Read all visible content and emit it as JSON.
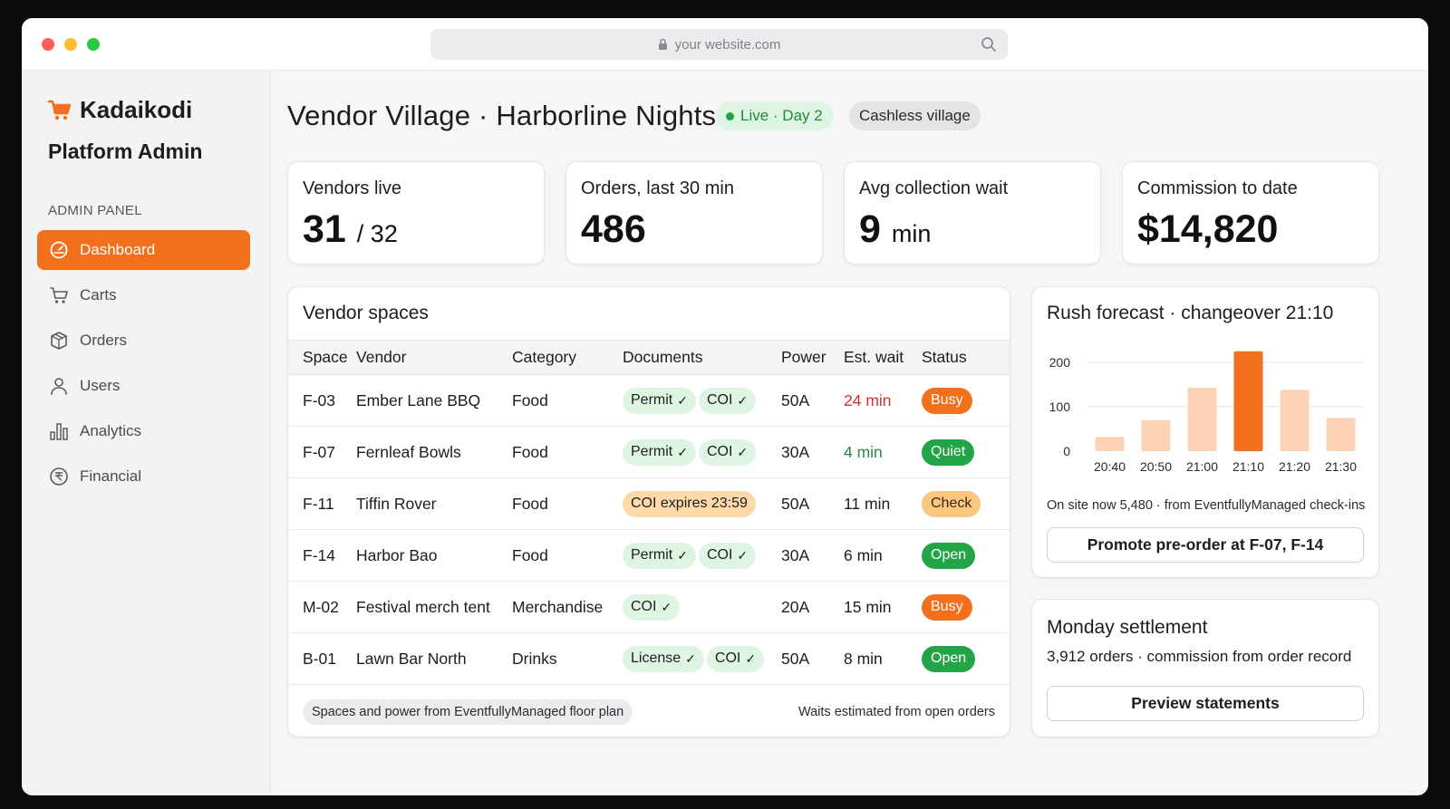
{
  "browser": {
    "url": "your website.com"
  },
  "brand": {
    "name": "Kadaikodi",
    "subtitle": "Platform Admin"
  },
  "sidebar": {
    "section_label": "ADMIN PANEL",
    "items": [
      {
        "label": "Dashboard",
        "icon": "gauge-icon",
        "active": true
      },
      {
        "label": "Carts",
        "icon": "cart-icon"
      },
      {
        "label": "Orders",
        "icon": "box-icon"
      },
      {
        "label": "Users",
        "icon": "user-icon"
      },
      {
        "label": "Analytics",
        "icon": "bar-chart-icon"
      },
      {
        "label": "Financial",
        "icon": "rupee-icon"
      }
    ]
  },
  "header": {
    "title": "Vendor Village · Harborline Nights",
    "live_pill": "Live · Day 2",
    "cash_pill": "Cashless village"
  },
  "kpis": [
    {
      "label": "Vendors live",
      "value": "31",
      "suffix": "/ 32"
    },
    {
      "label": "Orders, last 30 min",
      "value": "486",
      "suffix": ""
    },
    {
      "label": "Avg collection wait",
      "value": "9",
      "suffix": "min"
    },
    {
      "label": "Commission to date",
      "value": "$14,820",
      "suffix": ""
    }
  ],
  "vendor_spaces": {
    "title": "Vendor spaces",
    "columns": [
      "Space",
      "Vendor",
      "Category",
      "Documents",
      "Power",
      "Est. wait",
      "Status"
    ],
    "rows": [
      {
        "space": "F-03",
        "vendor": "Ember Lane BBQ",
        "category": "Food",
        "docs": [
          {
            "label": "Permit",
            "ok": true
          },
          {
            "label": "COI",
            "ok": true
          }
        ],
        "power": "50A",
        "wait": "24 min",
        "wait_color": "red",
        "status": "Busy"
      },
      {
        "space": "F-07",
        "vendor": "Fernleaf Bowls",
        "category": "Food",
        "docs": [
          {
            "label": "Permit",
            "ok": true
          },
          {
            "label": "COI",
            "ok": true
          }
        ],
        "power": "30A",
        "wait": "4 min",
        "wait_color": "green",
        "status": "Quiet"
      },
      {
        "space": "F-11",
        "vendor": "Tiffin Rover",
        "category": "Food",
        "docs": [
          {
            "label": "COI expires 23:59",
            "ok": false
          }
        ],
        "power": "50A",
        "wait": "11 min",
        "wait_color": "",
        "status": "Check"
      },
      {
        "space": "F-14",
        "vendor": "Harbor Bao",
        "category": "Food",
        "docs": [
          {
            "label": "Permit",
            "ok": true
          },
          {
            "label": "COI",
            "ok": true
          }
        ],
        "power": "30A",
        "wait": "6 min",
        "wait_color": "",
        "status": "Open"
      },
      {
        "space": "M-02",
        "vendor": "Festival merch tent",
        "category": "Merchandise",
        "docs": [
          {
            "label": "COI",
            "ok": true
          }
        ],
        "power": "20A",
        "wait": "15 min",
        "wait_color": "",
        "status": "Busy"
      },
      {
        "space": "B-01",
        "vendor": "Lawn Bar North",
        "category": "Drinks",
        "docs": [
          {
            "label": "License",
            "ok": true
          },
          {
            "label": "COI",
            "ok": true
          }
        ],
        "power": "50A",
        "wait": "8 min",
        "wait_color": "",
        "status": "Open"
      }
    ],
    "footer_pill": "Spaces and power from EventfullyManaged floor plan",
    "footer_note": "Waits estimated from open orders"
  },
  "status_colors": {
    "Busy": "#f26f1d",
    "Quiet": "#22a447",
    "Check": "#f9c77f",
    "Open": "#22a447"
  },
  "rush": {
    "title": "Rush forecast · changeover 21:10",
    "note": "On site now 5,480 · from EventfullyManaged check-ins",
    "button": "Promote pre-order at F-07, F-14"
  },
  "chart_data": {
    "type": "bar",
    "categories": [
      "20:40",
      "20:50",
      "21:00",
      "21:10",
      "21:20",
      "21:30"
    ],
    "values": [
      32,
      70,
      143,
      225,
      138,
      75
    ],
    "highlight": "21:10",
    "ylim": [
      0,
      200
    ],
    "yticks": [
      0,
      100,
      200
    ],
    "grid": true,
    "colors": {
      "bar": "#fcd2b4",
      "highlight": "#f26f1d"
    }
  },
  "settlement": {
    "title": "Monday settlement",
    "subtitle": "3,912 orders · commission from order record",
    "button": "Preview statements"
  }
}
